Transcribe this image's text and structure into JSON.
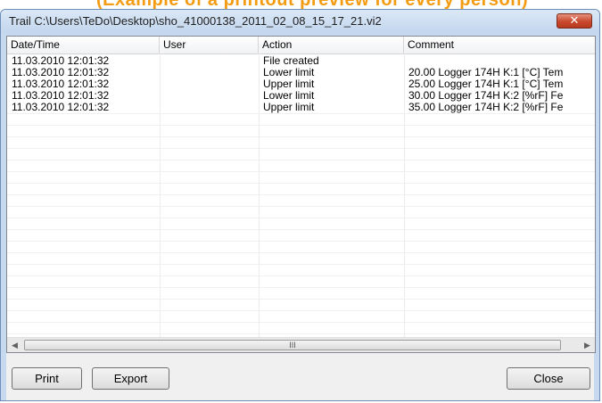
{
  "banner_text": "(Example of a printout preview for every person)",
  "window": {
    "title": "Trail C:\\Users\\TeDo\\Desktop\\sho_41000138_2011_02_08_15_17_21.vi2",
    "close_glyph": "✕"
  },
  "list": {
    "columns": [
      "Date/Time",
      "User",
      "Action",
      "Comment"
    ],
    "rows": [
      {
        "datetime": "11.03.2010 12:01:32",
        "user": "",
        "action": "File created",
        "comment": ""
      },
      {
        "datetime": "11.03.2010 12:01:32",
        "user": "",
        "action": "Lower limit",
        "comment": "20.00 Logger 174H  K:1 [°C] Tem"
      },
      {
        "datetime": "11.03.2010 12:01:32",
        "user": "",
        "action": "Upper limit",
        "comment": "25.00 Logger 174H  K:1 [°C] Tem"
      },
      {
        "datetime": "11.03.2010 12:01:32",
        "user": "",
        "action": "Lower limit",
        "comment": "30.00 Logger 174H  K:2 [%rF] Fe"
      },
      {
        "datetime": "11.03.2010 12:01:32",
        "user": "",
        "action": "Upper limit",
        "comment": "35.00 Logger 174H  K:2 [%rF] Fe"
      }
    ]
  },
  "scrollbar": {
    "left_arrow": "◀",
    "right_arrow": "▶",
    "grip": "III"
  },
  "buttons": {
    "print": "Print",
    "export": "Export",
    "close": "Close"
  }
}
